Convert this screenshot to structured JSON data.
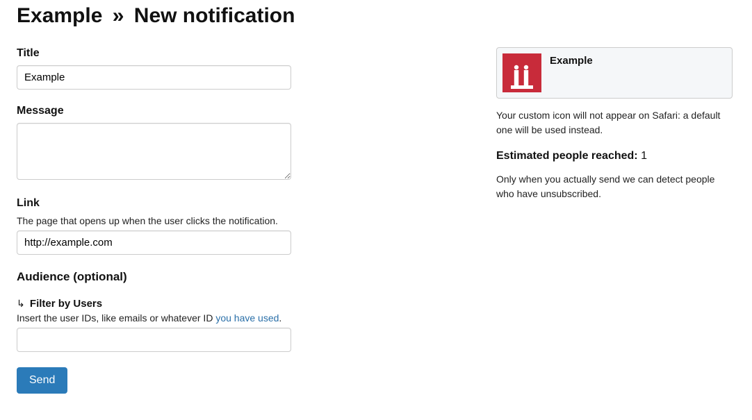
{
  "header": {
    "breadcrumb_parent": "Example",
    "separator": "»",
    "title": "New notification"
  },
  "form": {
    "title": {
      "label": "Title",
      "value": "Example"
    },
    "message": {
      "label": "Message",
      "value": ""
    },
    "link": {
      "label": "Link",
      "help": "The page that opens up when the user clicks the notification.",
      "value": "http://example.com"
    },
    "audience": {
      "heading": "Audience (optional)",
      "filter": {
        "heading": "Filter by Users",
        "help_pre": "Insert the user IDs, like emails or whatever ID ",
        "help_link": "you have used",
        "help_post": ".",
        "value": ""
      }
    },
    "send_button": "Send"
  },
  "sidebar": {
    "preview": {
      "title": "Example",
      "icon_color": "#c82b3a"
    },
    "safari_note": "Your custom icon will not appear on Safari: a default one will be used instead.",
    "estimated": {
      "label": "Estimated people reached",
      "count": "1"
    },
    "unsub_note": "Only when you actually send we can detect people who have unsubscribed."
  }
}
